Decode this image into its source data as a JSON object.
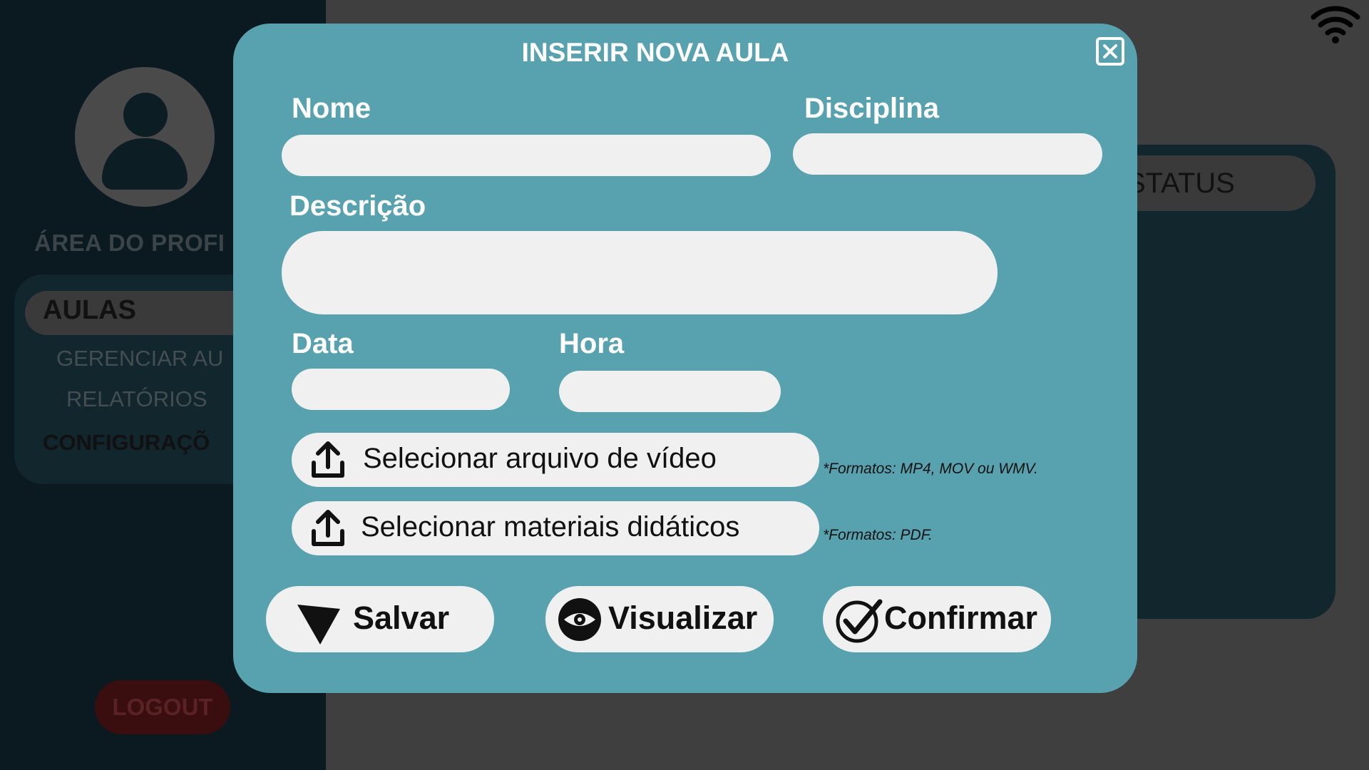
{
  "background": {
    "area_title": "ÁREA DO PROFI",
    "menu": {
      "aulas": "AULAS",
      "gerenciar": "GERENCIAR AU",
      "relatorios": "RELATÓRIOS",
      "configuracoes": "CONFIGURAÇÕ"
    },
    "logout_label": "LOGOUT",
    "status_header": "STATUS"
  },
  "modal": {
    "title": "INSERIR NOVA AULA",
    "close_icon": "close-icon",
    "fields": {
      "nome": {
        "label": "Nome",
        "value": ""
      },
      "disciplina": {
        "label": "Disciplina",
        "value": ""
      },
      "descricao": {
        "label": "Descrição",
        "value": ""
      },
      "data": {
        "label": "Data",
        "value": ""
      },
      "hora": {
        "label": "Hora",
        "value": ""
      }
    },
    "uploads": {
      "video": {
        "label": "Selecionar arquivo de vídeo",
        "note": "*Formatos: MP4, MOV ou WMV.",
        "icon": "upload-icon"
      },
      "materiais": {
        "label": "Selecionar materiais didáticos",
        "note": "*Formatos: PDF.",
        "icon": "upload-icon"
      }
    },
    "actions": {
      "salvar": {
        "label": "Salvar",
        "icon": "send-arrow-icon"
      },
      "visualizar": {
        "label": "Visualizar",
        "icon": "eye-icon"
      },
      "confirmar": {
        "label": "Confirmar",
        "icon": "check-circle-icon"
      }
    }
  },
  "colors": {
    "modal_bg": "#58a2b0",
    "field_bg": "#f0f0f0",
    "overlay_bg": "#3f3f3f",
    "sidebar_bg": "#0a1a20"
  }
}
